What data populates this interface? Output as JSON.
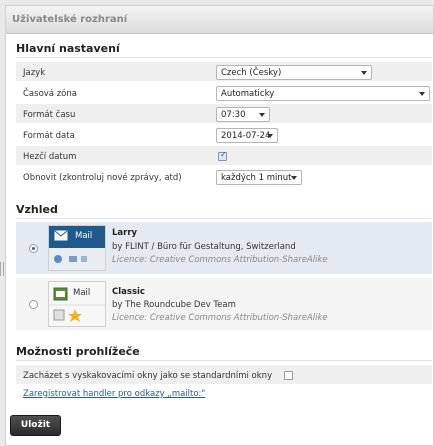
{
  "panel": {
    "title": "Uživatelské rozhraní"
  },
  "main_settings": {
    "heading": "Hlavní nastavení",
    "rows": [
      {
        "label": "Jazyk",
        "value": "Czech (Česky)"
      },
      {
        "label": "Časová zóna",
        "value": "Automaticky"
      },
      {
        "label": "Formát času",
        "value": "07:30"
      },
      {
        "label": "Formát data",
        "value": "2014-07-24"
      },
      {
        "label": "Hezčí datum",
        "checked": true
      },
      {
        "label": "Obnovit (zkontroluj nové zprávy, atd)",
        "value": "každých 1 minut"
      }
    ]
  },
  "appearance": {
    "heading": "Vzhled",
    "skins": [
      {
        "name": "Larry",
        "author": "by FLINT / Büro für Gestaltung, Switzerland",
        "license": "Licence: Creative Commons Attribution-ShareAlike",
        "selected": true,
        "thumb_label": "Mail"
      },
      {
        "name": "Classic",
        "author": "by The Roundcube Dev Team",
        "license": "Licence: Creative Commons Attribution-ShareAlike",
        "selected": false,
        "thumb_label": "Mail"
      }
    ]
  },
  "browser_options": {
    "heading": "Možnosti prohlížeče",
    "popup_label": "Zacházet s vyskakovacími okny jako se standardními okny",
    "popup_checked": false,
    "mailto_link": "Zaregistrovat handler pro odkazy „mailto:\""
  },
  "save_label": "Uložit",
  "colors": {
    "accent": "#2a5c9a",
    "selected_row": "#e4eaf2",
    "button": "#333333"
  }
}
